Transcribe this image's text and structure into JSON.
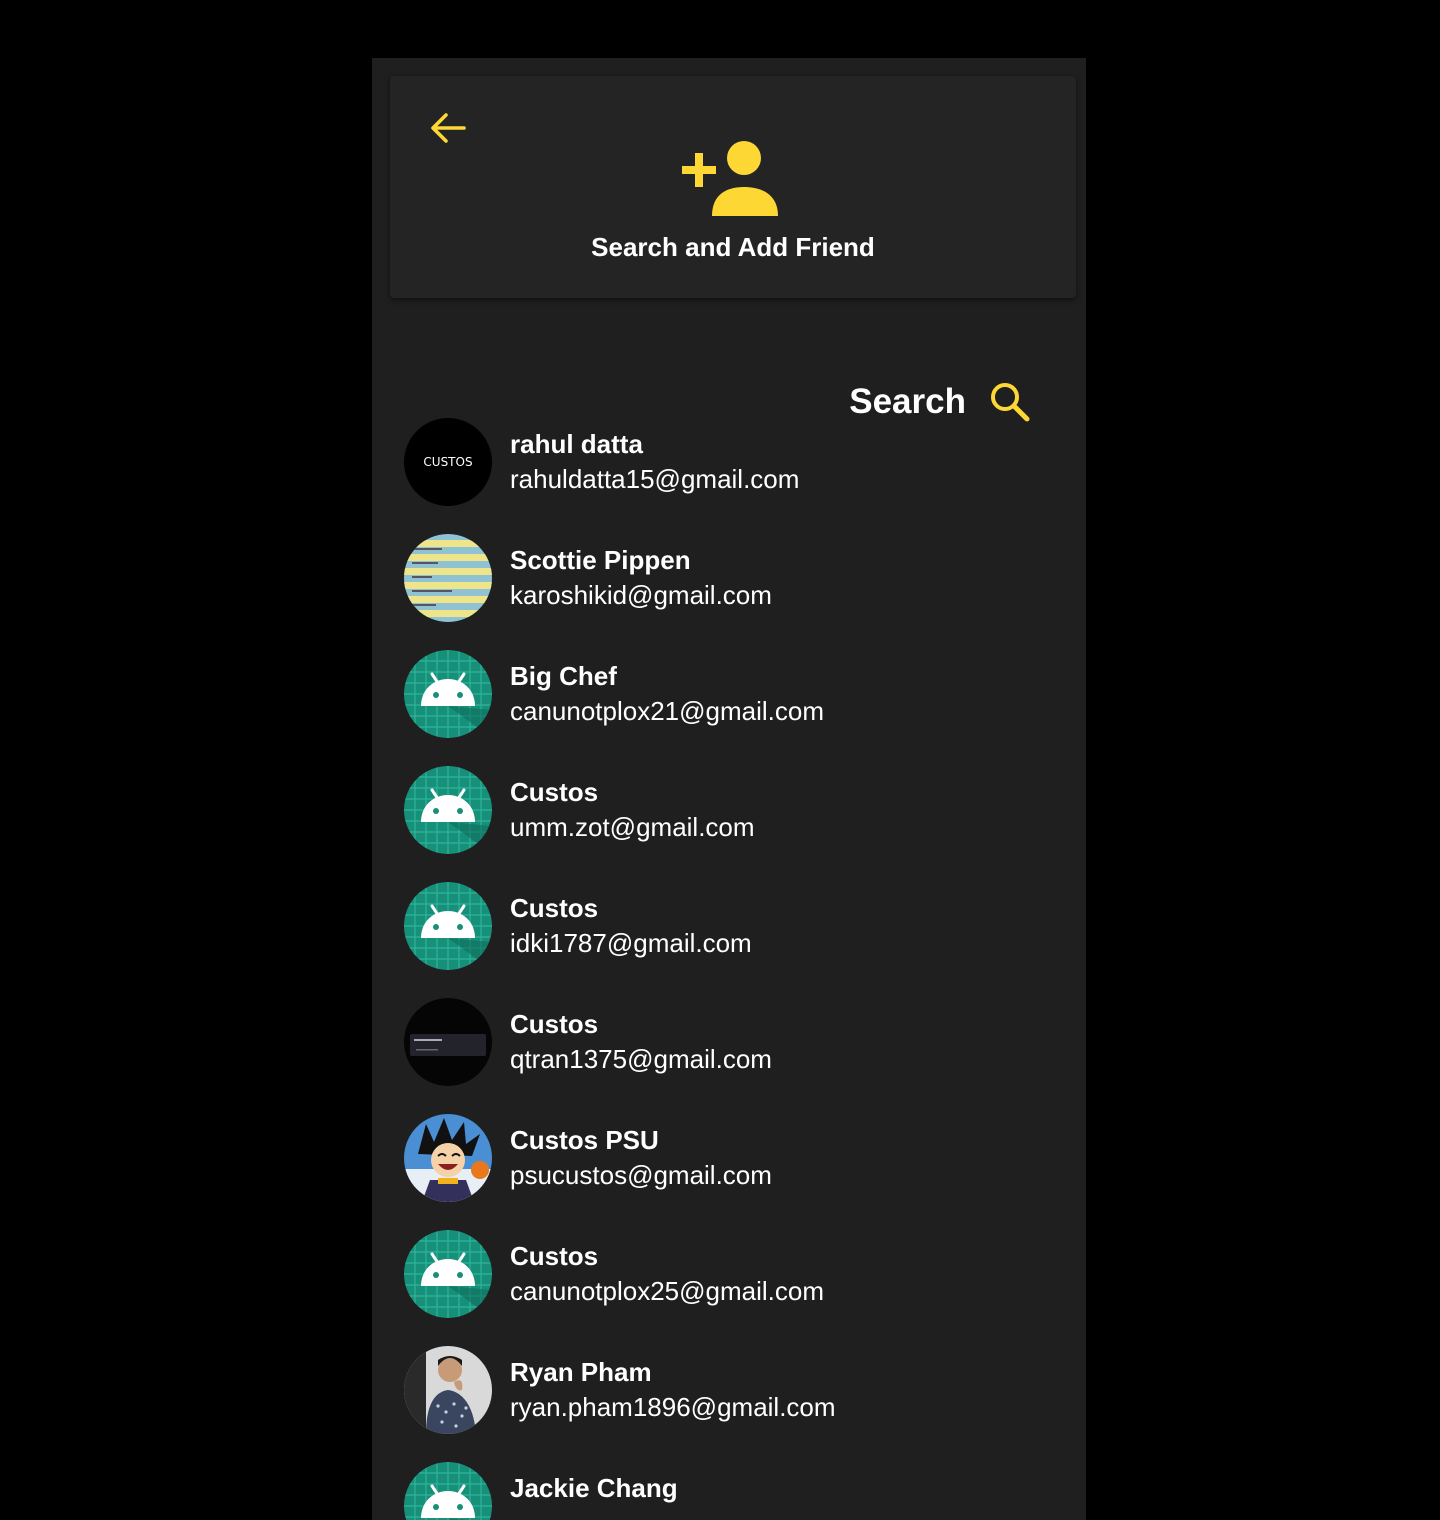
{
  "header": {
    "title": "Search and Add Friend",
    "back_icon": "arrow-left-icon",
    "hero_icon": "person-add-icon",
    "accent_color": "#FDD835"
  },
  "search": {
    "label": "Search",
    "icon": "search-icon"
  },
  "friends": [
    {
      "name": "rahul datta",
      "email": "rahuldatta15@gmail.com",
      "avatar": "custos-logo-avatar",
      "avatar_text": "CUSTOS"
    },
    {
      "name": "Scottie Pippen",
      "email": "karoshikid@gmail.com",
      "avatar": "striped-photo-avatar"
    },
    {
      "name": "Big Chef",
      "email": "canunotplox21@gmail.com",
      "avatar": "android-default-avatar"
    },
    {
      "name": "Custos",
      "email": "umm.zot@gmail.com",
      "avatar": "android-default-avatar"
    },
    {
      "name": "Custos",
      "email": "idki1787@gmail.com",
      "avatar": "android-default-avatar"
    },
    {
      "name": "Custos",
      "email": "qtran1375@gmail.com",
      "avatar": "dark-screenshot-avatar"
    },
    {
      "name": "Custos PSU",
      "email": "psucustos@gmail.com",
      "avatar": "cartoon-avatar"
    },
    {
      "name": "Custos",
      "email": "canunotplox25@gmail.com",
      "avatar": "android-default-avatar"
    },
    {
      "name": "Ryan Pham",
      "email": "ryan.pham1896@gmail.com",
      "avatar": "person-photo-avatar"
    },
    {
      "name": "Jackie Chang",
      "email": "",
      "avatar": "android-default-avatar"
    }
  ]
}
